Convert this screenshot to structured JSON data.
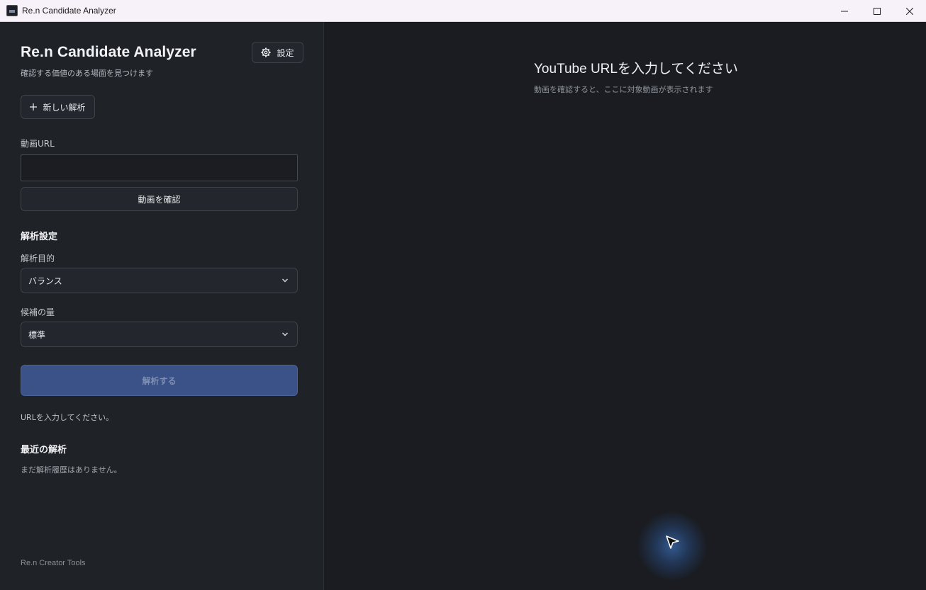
{
  "window": {
    "title": "Re.n Candidate Analyzer"
  },
  "sidebar": {
    "app_title": "Re.n Candidate Analyzer",
    "app_subtitle": "確認する価値のある場面を見つけます",
    "settings_label": "設定",
    "new_analysis_label": "新しい解析",
    "url_label": "動画URL",
    "url_value": "",
    "url_placeholder": "",
    "confirm_label": "動画を確認",
    "settings_section_title": "解析設定",
    "purpose_label": "解析目的",
    "purpose_value": "バランス",
    "amount_label": "候補の量",
    "amount_value": "標準",
    "analyze_label": "解析する",
    "hint": "URLを入力してください。",
    "recent_title": "最近の解析",
    "recent_empty": "まだ解析履歴はありません。",
    "footer": "Re.n Creator Tools"
  },
  "main": {
    "title": "YouTube URLを入力してください",
    "subtitle": "動画を確認すると、ここに対象動画が表示されます"
  },
  "colors": {
    "accent": "#3a5288",
    "sidebar_bg": "#1f2227",
    "main_bg": "#1a1c21"
  },
  "icons": {
    "settings": "gear-icon",
    "new": "plus-icon",
    "select": "chevron-down-icon",
    "minimize": "minimize-icon",
    "maximize": "maximize-icon",
    "close": "close-icon"
  }
}
